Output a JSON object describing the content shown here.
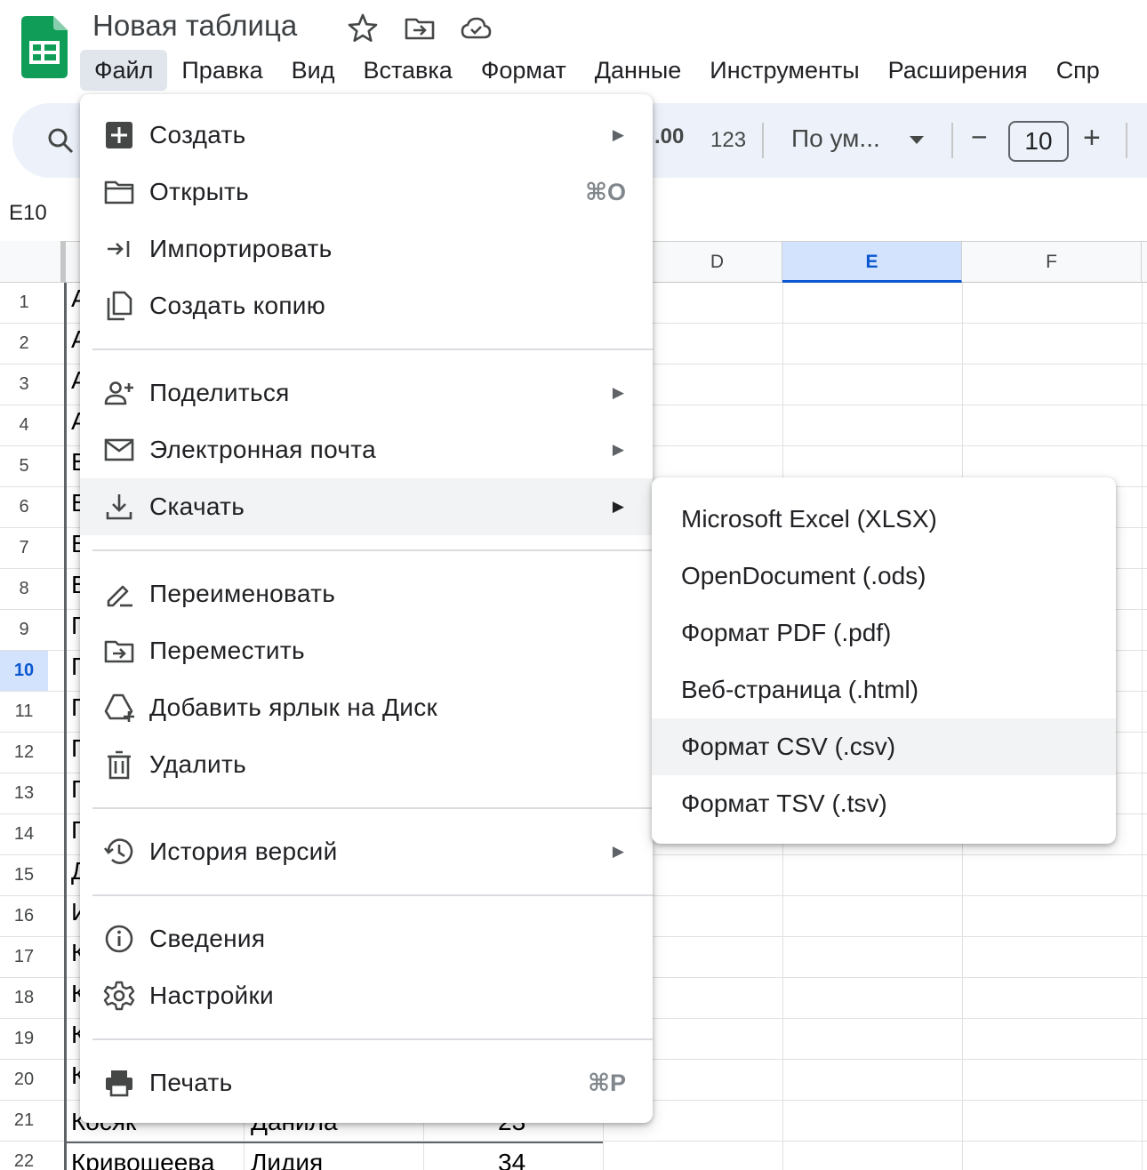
{
  "app": {
    "doc_title": "Новая таблица",
    "icons": [
      "sheets-logo",
      "star-icon",
      "move-folder-icon",
      "cloud-saved-icon"
    ]
  },
  "menubar": [
    "Файл",
    "Правка",
    "Вид",
    "Вставка",
    "Формат",
    "Данные",
    "Инструменты",
    "Расширения",
    "Спр"
  ],
  "toolbar": {
    "decimal_label": ".00",
    "number_format_label": "123",
    "font_selector": "По ум...",
    "font_size": "10",
    "minus": "−",
    "plus": "+"
  },
  "namebox": "E10",
  "grid": {
    "selected_cell": "E10",
    "columns": [
      "D",
      "E",
      "F"
    ],
    "rows": [
      "1",
      "2",
      "3",
      "4",
      "5",
      "6",
      "7",
      "8",
      "9",
      "10",
      "11",
      "12",
      "13",
      "14",
      "15",
      "16",
      "17",
      "18",
      "19",
      "20",
      "21",
      "22"
    ],
    "col_a_visible_chars": [
      "А",
      "А",
      "А",
      "А",
      "Б",
      "Б",
      "Б",
      "Б",
      "Г",
      "Г",
      "Г",
      "Г",
      "Г",
      "Г",
      "Д",
      "И",
      "К",
      "К",
      "К",
      "К"
    ],
    "row21": {
      "a": "Косяк",
      "b": "Данила",
      "c": "23"
    },
    "row22": {
      "a": "Кривошеева",
      "b": "Лидия",
      "c": "34"
    }
  },
  "file_menu": {
    "items": [
      {
        "label": "Создать",
        "icon": "new-sheet-icon",
        "shortcut": "",
        "arrow": "▶"
      },
      {
        "label": "Открыть",
        "icon": "folder-open-icon",
        "shortcut": "⌘O",
        "arrow": ""
      },
      {
        "label": "Импортировать",
        "icon": "import-icon",
        "shortcut": "",
        "arrow": ""
      },
      {
        "label": "Создать копию",
        "icon": "copy-icon",
        "shortcut": "",
        "arrow": ""
      },
      {
        "label": "Поделиться",
        "icon": "share-person-icon",
        "shortcut": "",
        "arrow": "▶"
      },
      {
        "label": "Электронная почта",
        "icon": "email-icon",
        "shortcut": "",
        "arrow": "▶"
      },
      {
        "label": "Скачать",
        "icon": "download-icon",
        "shortcut": "",
        "arrow": "▶"
      },
      {
        "label": "Переименовать",
        "icon": "rename-icon",
        "shortcut": "",
        "arrow": ""
      },
      {
        "label": "Переместить",
        "icon": "move-folder-icon",
        "shortcut": "",
        "arrow": ""
      },
      {
        "label": "Добавить ярлык на Диск",
        "icon": "drive-shortcut-icon",
        "shortcut": "",
        "arrow": ""
      },
      {
        "label": "Удалить",
        "icon": "trash-icon",
        "shortcut": "",
        "arrow": ""
      },
      {
        "label": "История версий",
        "icon": "history-icon",
        "shortcut": "",
        "arrow": "▶"
      },
      {
        "label": "Сведения",
        "icon": "info-icon",
        "shortcut": "",
        "arrow": ""
      },
      {
        "label": "Настройки",
        "icon": "settings-gear-icon",
        "shortcut": "",
        "arrow": ""
      },
      {
        "label": "Печать",
        "icon": "print-icon",
        "shortcut": "⌘P",
        "arrow": ""
      }
    ],
    "highlighted": "Скачать"
  },
  "download_submenu": {
    "items": [
      "Microsoft Excel (XLSX)",
      "OpenDocument (.ods)",
      "Формат PDF (.pdf)",
      "Веб-страница (.html)",
      "Формат CSV (.csv)",
      "Формат TSV (.tsv)"
    ],
    "highlighted": "Формат CSV (.csv)"
  },
  "colors": {
    "sheets_green": "#0f9d58",
    "selection_blue": "#d3e3fd",
    "selection_text": "#0b57d0",
    "toolbar_bg": "#edf2fa",
    "menu_highlight": "#f1f3f4"
  }
}
